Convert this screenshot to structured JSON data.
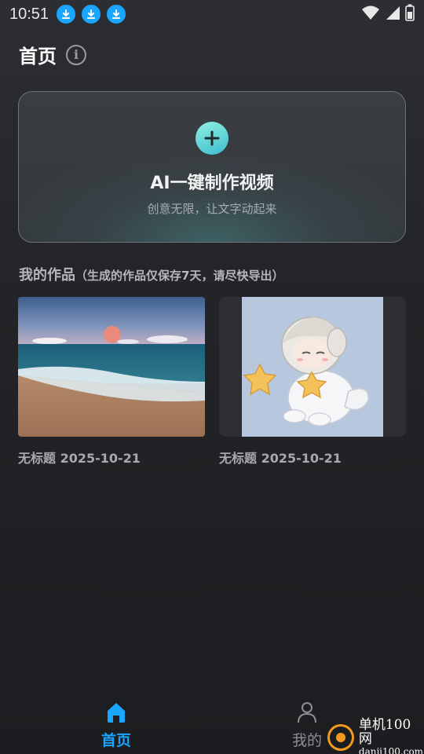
{
  "status_bar": {
    "time": "10:51",
    "download_icons": [
      "download-icon",
      "download-icon",
      "download-icon"
    ],
    "wifi_icon": "wifi-icon",
    "signal_icon": "signal-icon",
    "battery_icon": "battery-icon"
  },
  "header": {
    "title": "首页",
    "info_icon": "info-icon",
    "info_glyph": "i"
  },
  "create_card": {
    "icon": "plus-icon",
    "title": "AI一键制作视频",
    "subtitle": "创意无限，让文字动起来"
  },
  "works_section": {
    "title": "我的作品",
    "note": "（生成的作品仅保存7天，请尽快导出）",
    "items": [
      {
        "label": "无标题 2025-10-21",
        "thumbnail": "beach-sunset-image"
      },
      {
        "label": "无标题 2025-10-21",
        "thumbnail": "anime-character-image"
      }
    ]
  },
  "bottom_nav": {
    "items": [
      {
        "label": "首页",
        "icon": "home-icon",
        "active": true
      },
      {
        "label": "我的",
        "icon": "person-icon",
        "active": false
      }
    ]
  },
  "watermark": {
    "line1": "单机100网",
    "line2": "danji100.com"
  },
  "colors": {
    "accent": "#1aa6ff",
    "plus_gradient_start": "#8ef0e0",
    "plus_gradient_end": "#3fbcd0",
    "watermark_orange": "#f39a1e"
  }
}
